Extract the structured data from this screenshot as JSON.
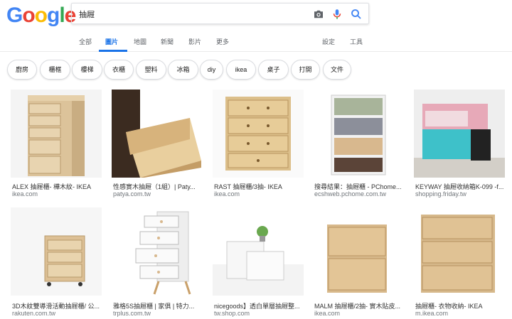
{
  "search": {
    "query": "抽屜"
  },
  "logo": {
    "letters": [
      "G",
      "o",
      "o",
      "g",
      "l",
      "e"
    ],
    "colors": [
      "#4285f4",
      "#ea4335",
      "#fbbc05",
      "#4285f4",
      "#34a853",
      "#ea4335"
    ]
  },
  "tabs": [
    {
      "label": "全部"
    },
    {
      "label": "圖片"
    },
    {
      "label": "地圖"
    },
    {
      "label": "新聞"
    },
    {
      "label": "影片"
    },
    {
      "label": "更多"
    },
    {
      "label": "設定"
    },
    {
      "label": "工具"
    }
  ],
  "chips": [
    "廚房",
    "櫃框",
    "樓梯",
    "衣櫃",
    "塑料",
    "冰箱",
    "diy",
    "ikea",
    "桌子",
    "打開",
    "文件"
  ],
  "results": [
    {
      "title": "ALEX 抽屜櫃- 樺木紋- IKEA",
      "site": "ikea.com"
    },
    {
      "title": "性感實木抽屜（1組）| Paty...",
      "site": "patya.com.tw"
    },
    {
      "title": "RAST 抽屜櫃/3抽- IKEA",
      "site": "ikea.com"
    },
    {
      "title": "搜尋結果：抽屜櫃 - PChome...",
      "site": "ecshweb.pchome.com.tw"
    },
    {
      "title": "KEYWAY 抽屜收納箱K-099 -f...",
      "site": "shopping.friday.tw"
    },
    {
      "title": "3D木紋雙導滑活動抽屜櫃/ 公...",
      "site": "rakuten.com.tw"
    },
    {
      "title": "雅格5S抽屜櫃 | 家俱 | 特力...",
      "site": "trplus.com.tw"
    },
    {
      "title": "nicegoods】透白單層抽屜整...",
      "site": "tw.shop.com"
    },
    {
      "title": "MALM 抽屜櫃/2抽- 實木貼皮...",
      "site": "ikea.com"
    },
    {
      "title": "抽屜櫃- 衣物收納- IKEA",
      "site": "m.ikea.com"
    }
  ]
}
